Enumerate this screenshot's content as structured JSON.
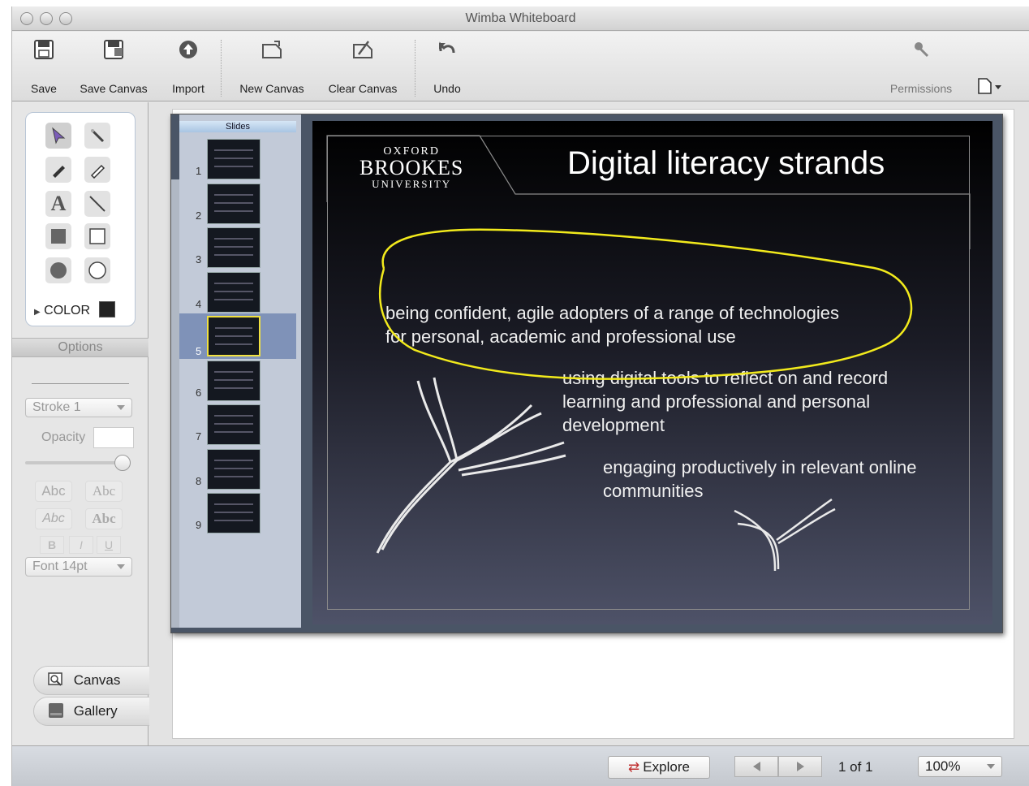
{
  "window": {
    "title": "Wimba Whiteboard"
  },
  "toolbar": {
    "save": "Save",
    "save_canvas": "Save Canvas",
    "import": "Import",
    "new_canvas": "New Canvas",
    "clear_canvas": "Clear Canvas",
    "undo": "Undo",
    "permissions": "Permissions"
  },
  "palette": {
    "color_label": "COLOR",
    "color_value": "#222222",
    "options_header": "Options",
    "stroke": "Stroke 1",
    "opacity_label": "Opacity",
    "opacity_value": 1.0,
    "text_styles": [
      "Abc",
      "Abc",
      "Abc",
      "Abc"
    ],
    "bold": "B",
    "italic": "I",
    "underline": "U",
    "font": "Font 14pt"
  },
  "nav": {
    "canvas": "Canvas",
    "gallery": "Gallery"
  },
  "slides_panel": {
    "header": "Slides",
    "numbers": [
      "1",
      "2",
      "3",
      "4",
      "5",
      "6",
      "7",
      "8",
      "9"
    ],
    "selected": 5
  },
  "slide": {
    "logo_top": "OXFORD",
    "logo_mid": "BROOKES",
    "logo_bottom": "UNIVERSITY",
    "title": "Digital literacy strands",
    "bullet1_line1": "being confident, agile adopters of a range of technologies",
    "bullet1_line2": "for personal, academic and professional use",
    "bullet2_line1": "using digital tools to reflect on and record",
    "bullet2_line2": "learning and professional and personal",
    "bullet2_line3": "development",
    "bullet3_line1": "engaging productively in relevant online",
    "bullet3_line2": "communities",
    "annotation_color": "#f2ea1c"
  },
  "status": {
    "explore": "Explore",
    "page_info": "1 of 1",
    "zoom": "100%"
  }
}
